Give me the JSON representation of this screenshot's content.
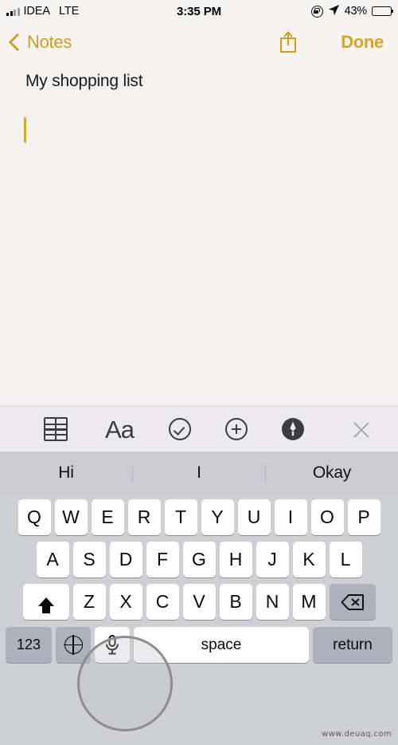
{
  "status_bar": {
    "carrier": "IDEA",
    "network": "LTE",
    "time": "3:35 PM",
    "battery_percent": "43%",
    "battery_level": 43,
    "icons": [
      "signal-bars-icon",
      "rotation-lock-icon",
      "location-arrow-icon",
      "battery-icon"
    ]
  },
  "nav_bar": {
    "back_label": "Notes",
    "share_icon": "share-icon",
    "done_label": "Done"
  },
  "note": {
    "title": "My shopping list",
    "body": "",
    "caret_visible": true,
    "caret_color": "#d8a72a"
  },
  "format_toolbar": {
    "items": [
      {
        "name": "table-icon",
        "label": "Table"
      },
      {
        "name": "text-format-icon",
        "label": "Aa"
      },
      {
        "name": "checklist-icon",
        "label": "Checklist"
      },
      {
        "name": "add-attachment-icon",
        "label": "Add"
      },
      {
        "name": "markup-icon",
        "label": "Markup"
      },
      {
        "name": "close-icon",
        "label": "Close"
      }
    ]
  },
  "keyboard": {
    "predictions": [
      "Hi",
      "I",
      "Okay"
    ],
    "row1": [
      "Q",
      "W",
      "E",
      "R",
      "T",
      "Y",
      "U",
      "I",
      "O",
      "P"
    ],
    "row2": [
      "A",
      "S",
      "D",
      "F",
      "G",
      "H",
      "J",
      "K",
      "L"
    ],
    "row3": [
      "Z",
      "X",
      "C",
      "V",
      "B",
      "N",
      "M"
    ],
    "shift_label": "shift",
    "delete_label": "delete",
    "numbers_label": "123",
    "globe_label": "globe",
    "dictation_label": "dictation",
    "space_label": "space",
    "return_label": "return"
  },
  "annotation": {
    "target": "dictation-key",
    "shape": "circle",
    "color": "#8d8d8d"
  },
  "watermark": {
    "text": "www.deuaq.com"
  },
  "colors": {
    "accent_gold": "#d7a520",
    "note_bg": "#f3f2f0",
    "keyboard_bg": "#cfcfd6",
    "key_white": "#ffffff",
    "key_gray": "#aeb1bc",
    "toolbar_bg": "#eceaf0"
  }
}
